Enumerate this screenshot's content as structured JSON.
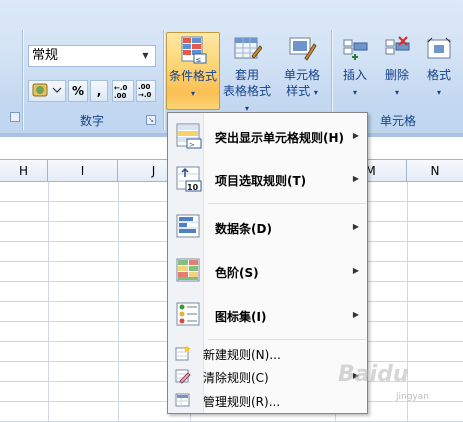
{
  "ribbon": {
    "number_format": {
      "value": "常规"
    },
    "number_buttons": [
      "%",
      ",",
      ".0→.00",
      ".00→.0"
    ],
    "number_group_label": "数字",
    "styles": {
      "conditional_format": {
        "line1": "条件格式",
        "dropdown": "▾"
      },
      "table_format": {
        "line1": "套用",
        "line2": "表格格式",
        "dropdown": "▾"
      },
      "cell_style": {
        "line1": "单元格",
        "line2": "样式",
        "dropdown": "▾"
      }
    },
    "cells": {
      "insert": {
        "label": "插入",
        "dropdown": "▾"
      },
      "delete": {
        "label": "删除",
        "dropdown": "▾"
      },
      "format": {
        "label": "格式",
        "dropdown": "▾"
      },
      "group_label": "单元格"
    }
  },
  "columns": [
    "H",
    "I",
    "J",
    "M",
    "N"
  ],
  "menu": {
    "items_big": [
      {
        "label": "突出显示单元格规则(H)",
        "icon": "highlight-cells-rules-icon",
        "has_submenu": true
      },
      {
        "label": "项目选取规则(T)",
        "icon": "top-bottom-rules-icon",
        "has_submenu": true
      },
      {
        "label": "数据条(D)",
        "icon": "data-bars-icon",
        "has_submenu": true
      },
      {
        "label": "色阶(S)",
        "icon": "color-scales-icon",
        "has_submenu": true
      },
      {
        "label": "图标集(I)",
        "icon": "icon-sets-icon",
        "has_submenu": true
      }
    ],
    "items_small": [
      {
        "label": "新建规则(N)...",
        "icon": "new-rule-icon",
        "has_submenu": false
      },
      {
        "label": "清除规则(C)",
        "icon": "clear-rules-icon",
        "has_submenu": true
      },
      {
        "label": "管理规则(R)...",
        "icon": "manage-rules-icon",
        "has_submenu": false
      }
    ],
    "submenu_arrow": "▶"
  },
  "watermark": {
    "main": "Baidu",
    "sub": "jingyan"
  },
  "colors": {
    "ribbon": "#d2e2f5",
    "active_button": "#fbc054",
    "menu_bg": "#fafafa",
    "grid_line": "#d0d7e5"
  }
}
